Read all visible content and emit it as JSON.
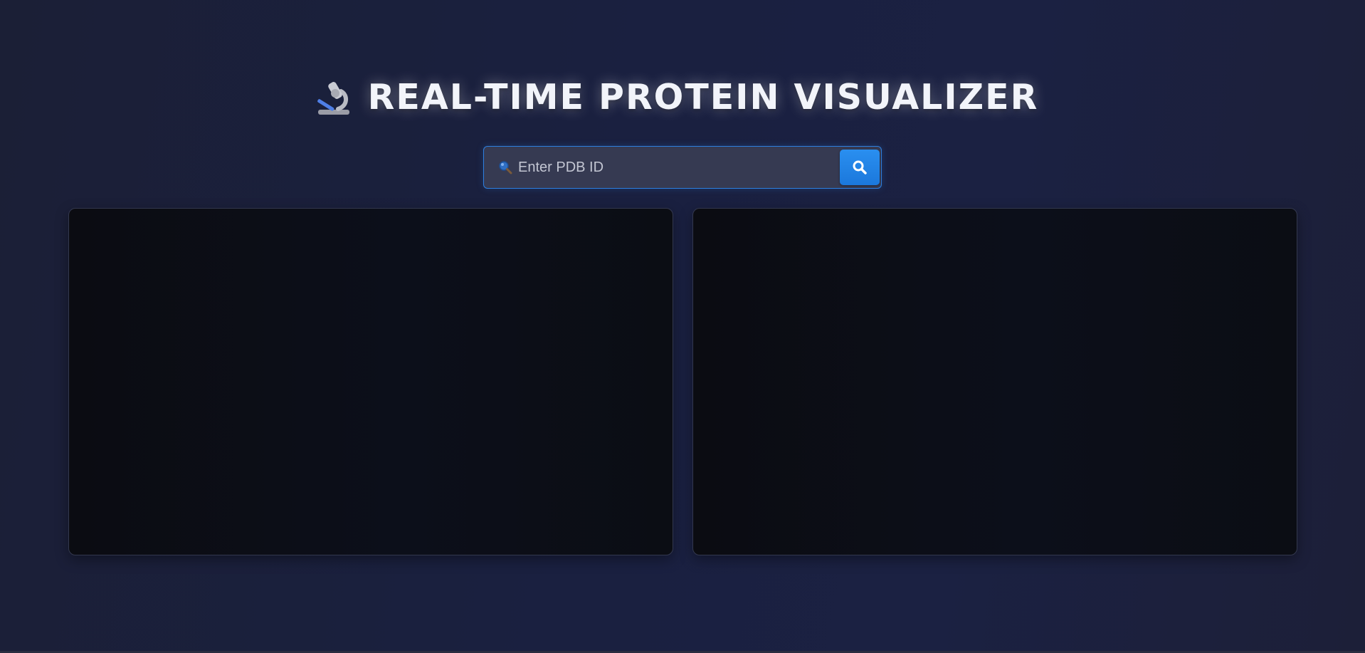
{
  "header": {
    "title": "REAL-TIME PROTEIN VISUALIZER",
    "icon": "microscope-icon"
  },
  "search": {
    "placeholder": "Enter PDB ID",
    "value": "",
    "leading_icon": "magnifier-icon",
    "button_icon": "search-icon"
  },
  "panels": [
    {
      "name": "viewer-panel-left",
      "content": ""
    },
    {
      "name": "viewer-panel-right",
      "content": ""
    }
  ],
  "colors": {
    "accent": "#1e88e5",
    "background": "#1b1f38",
    "panel": "#0b0d14",
    "title_text": "#f2f4fa"
  }
}
